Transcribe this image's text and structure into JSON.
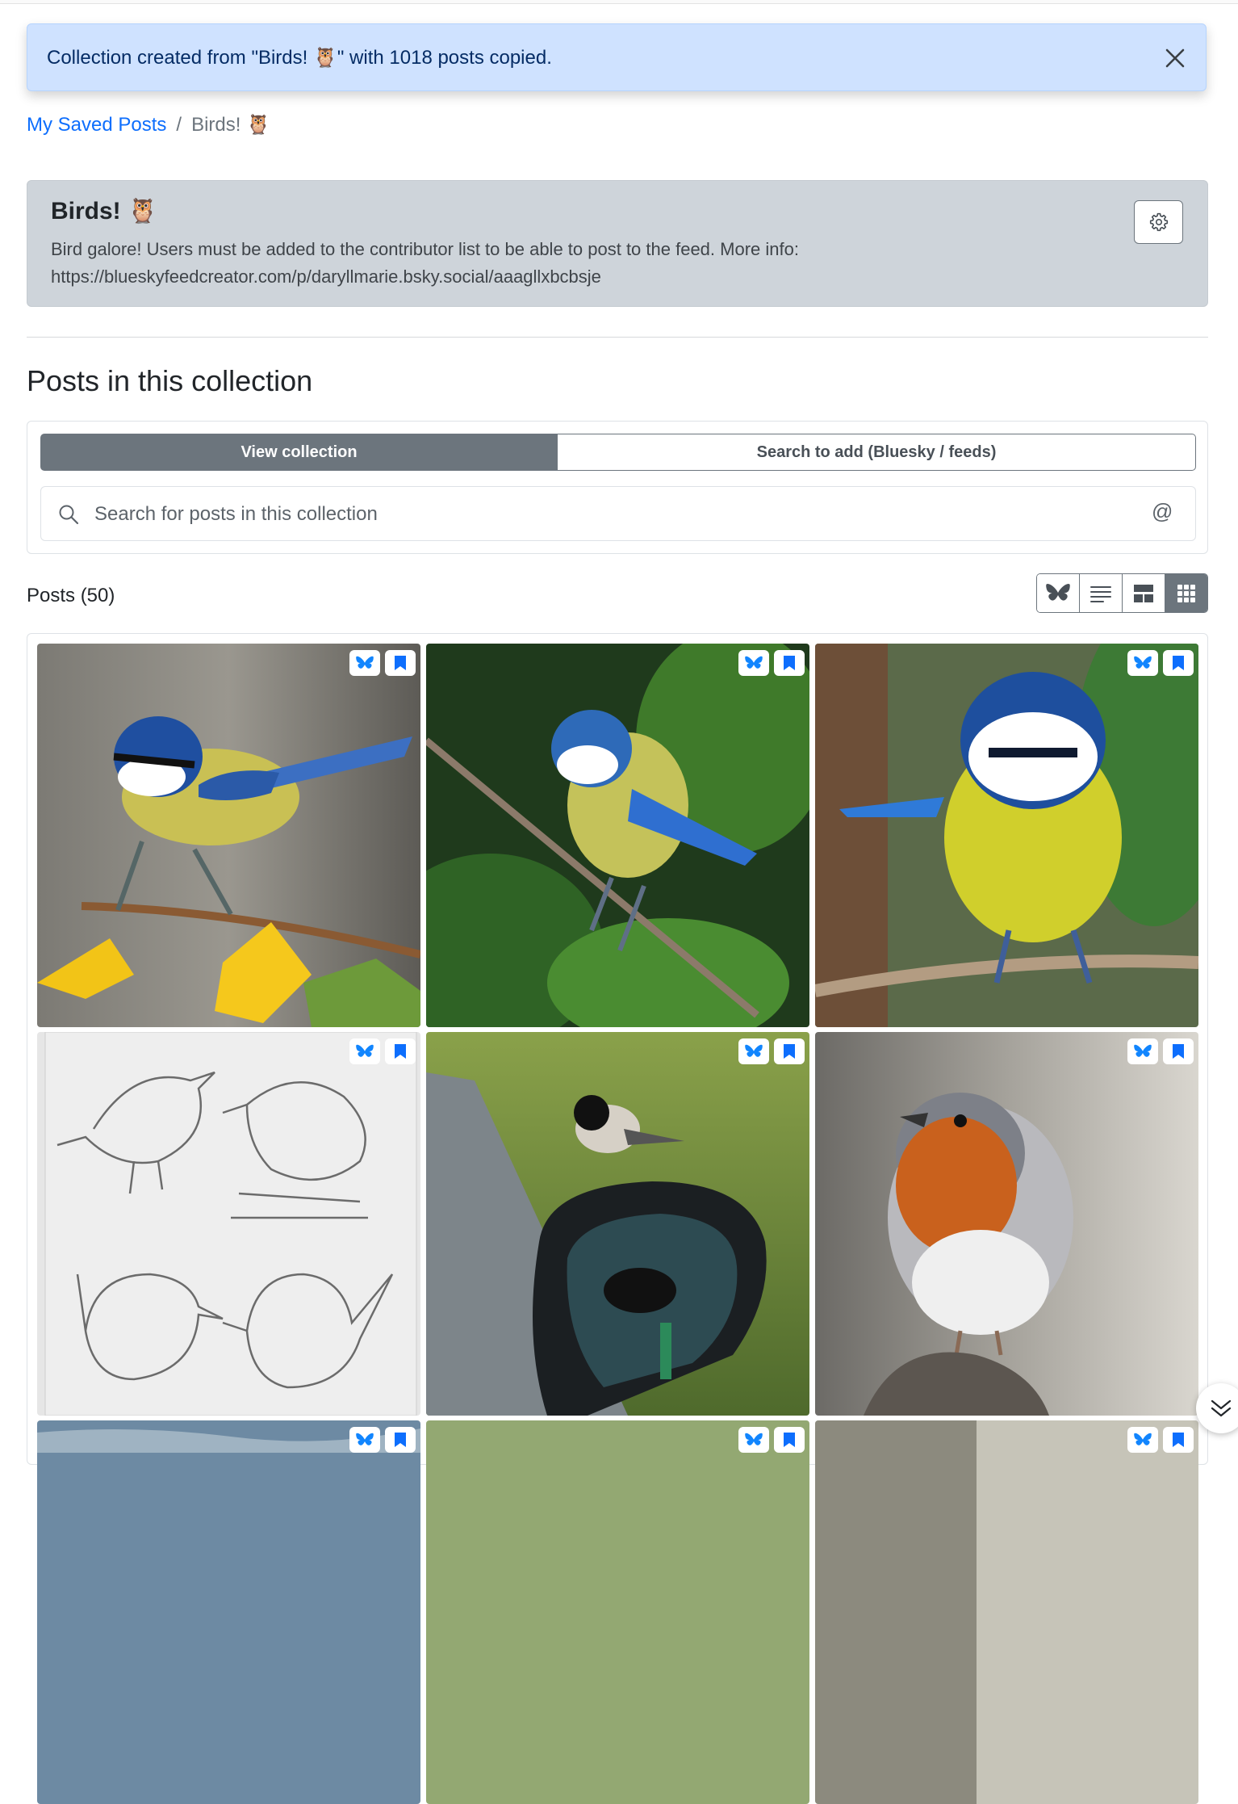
{
  "alert": {
    "message": "Collection created from \"Birds! 🦉\" with 1018 posts copied.",
    "close_icon": "close-icon"
  },
  "breadcrumb": {
    "home": "My Saved Posts",
    "separator": "/",
    "current": "Birds! 🦉"
  },
  "collection": {
    "title": "Birds! 🦉",
    "description": "Bird galore! Users must be added to the contributor list to be able to post to the feed. More info: https://blueskyfeedcreator.com/p/daryllmarie.bsky.social/aaagllxbcbsje",
    "settings_icon": "gear-icon"
  },
  "section": {
    "title": "Posts in this collection"
  },
  "tabs": [
    {
      "label": "View collection",
      "active": true
    },
    {
      "label": "Search to add (Bluesky / feeds)",
      "active": false
    }
  ],
  "search": {
    "placeholder": "Search for posts in this collection",
    "value": "",
    "handle_symbol": "@"
  },
  "posts": {
    "count_label": "Posts (50)",
    "view_modes": [
      {
        "icon": "bluesky-butterfly-icon",
        "active": false
      },
      {
        "icon": "list-lines-icon",
        "active": false
      },
      {
        "icon": "layout-icon",
        "active": false
      },
      {
        "icon": "grid-icon",
        "active": true
      }
    ],
    "items": [
      {
        "subject": "blue tit on forsythia branch"
      },
      {
        "subject": "blue tit on thin twig"
      },
      {
        "subject": "blue tit facing forward on branch"
      },
      {
        "subject": "pencil sketches of wrens"
      },
      {
        "subject": "chickadee on car side mirror"
      },
      {
        "subject": "european robin on stump"
      },
      {
        "subject": "bird photo (partially visible)"
      },
      {
        "subject": "bird photo (partially visible)"
      },
      {
        "subject": "bird photo (partially visible)"
      }
    ]
  },
  "colors": {
    "primary": "#0d6efd",
    "alert_bg": "#cfe2ff",
    "card_bg": "#ced4da",
    "secondary": "#6c757d",
    "bluesky_blue": "#1185fe"
  }
}
